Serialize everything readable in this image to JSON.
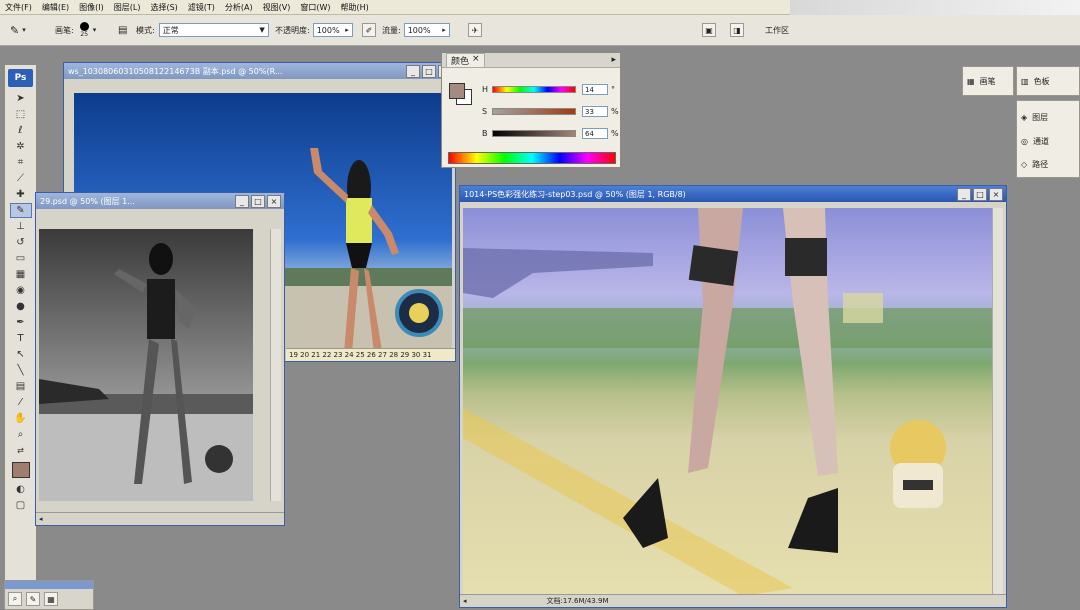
{
  "menu": [
    "文件(F)",
    "编辑(E)",
    "图像(I)",
    "图层(L)",
    "选择(S)",
    "滤镜(T)",
    "分析(A)",
    "视图(V)",
    "窗口(W)",
    "帮助(H)"
  ],
  "options": {
    "brush_label": "画笔:",
    "brush_size": "25",
    "mode_label": "模式:",
    "mode_value": "正常",
    "opacity_label": "不透明度:",
    "opacity_value": "100%",
    "flow_label": "流量:",
    "flow_value": "100%",
    "workspace_label": "工作区"
  },
  "toolbox": {
    "logo": "Ps"
  },
  "windows": {
    "top_doc": {
      "title": "ws_1030806031050812214673B 副本.psd @ 50%(R..."
    },
    "left_doc": {
      "title": "29.psd @ 50% (图层 1..."
    },
    "main_doc": {
      "title": "1014-PS色彩强化练习-step03.psd @ 50% (图层 1, RGB/8)",
      "status": "文档:17.6M/43.9M"
    },
    "ruler_digits": "19 20 21 22 23 24 25 26 27 28 29 30 31"
  },
  "color_panel": {
    "tab": "颜色",
    "close": "×",
    "channels": [
      {
        "label": "H",
        "value": "14",
        "unit": "°"
      },
      {
        "label": "S",
        "value": "33",
        "unit": "%"
      },
      {
        "label": "B",
        "value": "64",
        "unit": "%"
      }
    ],
    "fg_color": "#a48a80",
    "bg_color": "#ffffff"
  },
  "side_panels": {
    "brushes": "画笔",
    "color": "色板",
    "layers": "图层",
    "channels": "通道",
    "paths": "路径"
  }
}
